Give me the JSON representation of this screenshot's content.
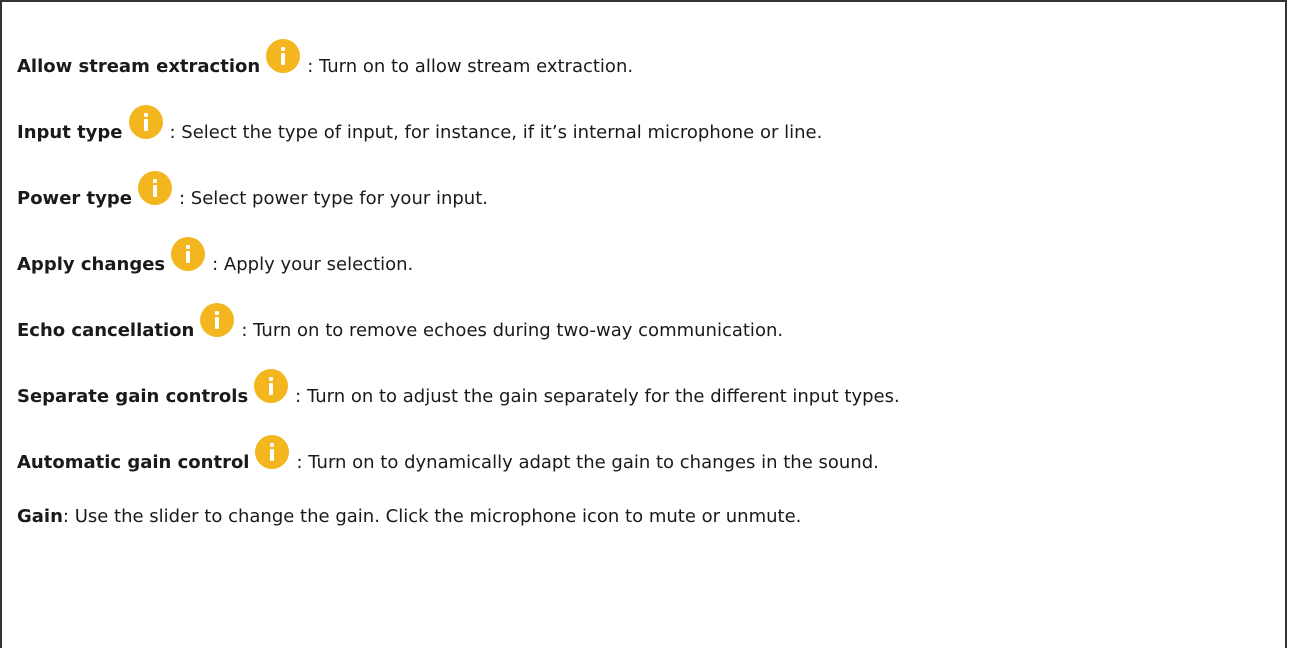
{
  "items": [
    {
      "term": "Allow stream extraction",
      "desc": ": Turn on to allow stream extraction.",
      "has_info": true
    },
    {
      "term": "Input type",
      "desc": ": Select the type of input, for instance, if it’s internal microphone or line.",
      "has_info": true
    },
    {
      "term": "Power type",
      "desc": ": Select power type for your input.",
      "has_info": true
    },
    {
      "term": "Apply changes",
      "desc": ": Apply your selection.",
      "has_info": true
    },
    {
      "term": "Echo cancellation",
      "desc": ": Turn on to remove echoes during two-way communication.",
      "has_info": true
    },
    {
      "term": "Separate gain controls",
      "desc": ": Turn on to adjust the gain separately for the different input types.",
      "has_info": true
    },
    {
      "term": "Automatic gain control",
      "desc": ": Turn on to dynamically adapt the gain to changes in the sound.",
      "has_info": true
    },
    {
      "term": "Gain",
      "desc": ": Use the slider to change the gain. Click the microphone icon to mute or unmute.",
      "has_info": false
    }
  ],
  "colors": {
    "info_icon": "#f3b61f",
    "border": "#333333"
  },
  "icon": "info-icon"
}
